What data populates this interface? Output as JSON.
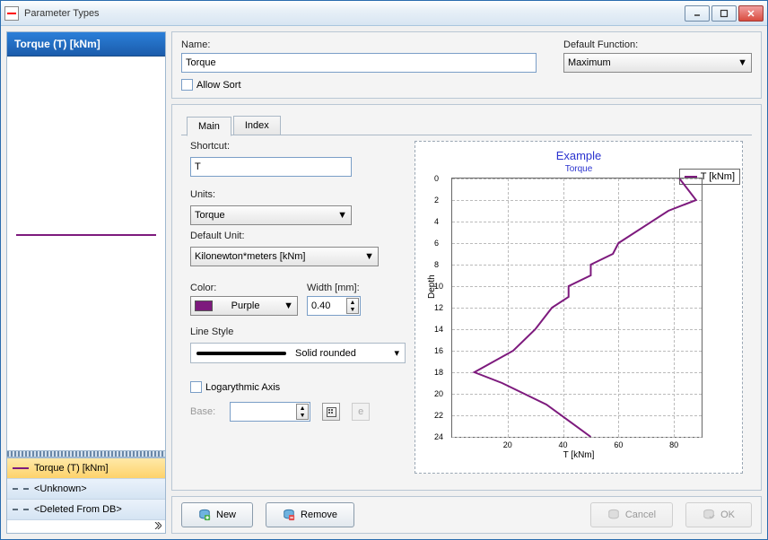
{
  "window": {
    "title": "Parameter Types"
  },
  "sidebar": {
    "header": "Torque (T) [kNm]",
    "items": [
      {
        "label": "Torque (T) [kNm]",
        "style": "solid",
        "selected": true
      },
      {
        "label": "<Unknown>",
        "style": "dash",
        "selected": false
      },
      {
        "label": "<Deleted From DB>",
        "style": "dash",
        "selected": false
      }
    ]
  },
  "top": {
    "name_label": "Name:",
    "name_value": "Torque",
    "default_fn_label": "Default Function:",
    "default_fn_value": "Maximum",
    "allow_sort_label": "Allow Sort"
  },
  "tabs": [
    {
      "label": "Main",
      "active": true
    },
    {
      "label": "Index",
      "active": false
    }
  ],
  "form": {
    "shortcut_label": "Shortcut:",
    "shortcut_value": "T",
    "units_label": "Units:",
    "units_value": "Torque",
    "default_unit_label": "Default Unit:",
    "default_unit_value": "Kilonewton*meters [kNm]",
    "color_label": "Color:",
    "color_value": "Purple",
    "color_hex": "#7d1a7d",
    "width_label": "Width [mm]:",
    "width_value": "0.40",
    "line_style_label": "Line Style",
    "line_style_value": "Solid rounded",
    "log_axis_label": "Logarythmic Axis",
    "base_label": "Base:",
    "base_btn_e": "e"
  },
  "buttons": {
    "new": "New",
    "remove": "Remove",
    "cancel": "Cancel",
    "ok": "OK"
  },
  "chart_data": {
    "type": "line",
    "title": "Example",
    "subtitle": "Torque",
    "legend": "T [kNm]",
    "xlabel": "T [kNm]",
    "ylabel": "Depth",
    "xlim": [
      0,
      90
    ],
    "ylim": [
      0,
      24
    ],
    "xticks": [
      20,
      40,
      60,
      80
    ],
    "yticks": [
      0,
      2,
      4,
      6,
      8,
      10,
      12,
      14,
      16,
      18,
      20,
      22,
      24
    ],
    "series": [
      {
        "name": "T [kNm]",
        "color": "#7d1a7d",
        "points": [
          {
            "x": 82,
            "depth": 0
          },
          {
            "x": 88,
            "depth": 2
          },
          {
            "x": 78,
            "depth": 3
          },
          {
            "x": 60,
            "depth": 6
          },
          {
            "x": 58,
            "depth": 7
          },
          {
            "x": 50,
            "depth": 8
          },
          {
            "x": 50,
            "depth": 9
          },
          {
            "x": 42,
            "depth": 10
          },
          {
            "x": 42,
            "depth": 11
          },
          {
            "x": 36,
            "depth": 12
          },
          {
            "x": 30,
            "depth": 14
          },
          {
            "x": 22,
            "depth": 16
          },
          {
            "x": 8,
            "depth": 18
          },
          {
            "x": 18,
            "depth": 19
          },
          {
            "x": 34,
            "depth": 21
          },
          {
            "x": 50,
            "depth": 24
          }
        ]
      }
    ]
  }
}
